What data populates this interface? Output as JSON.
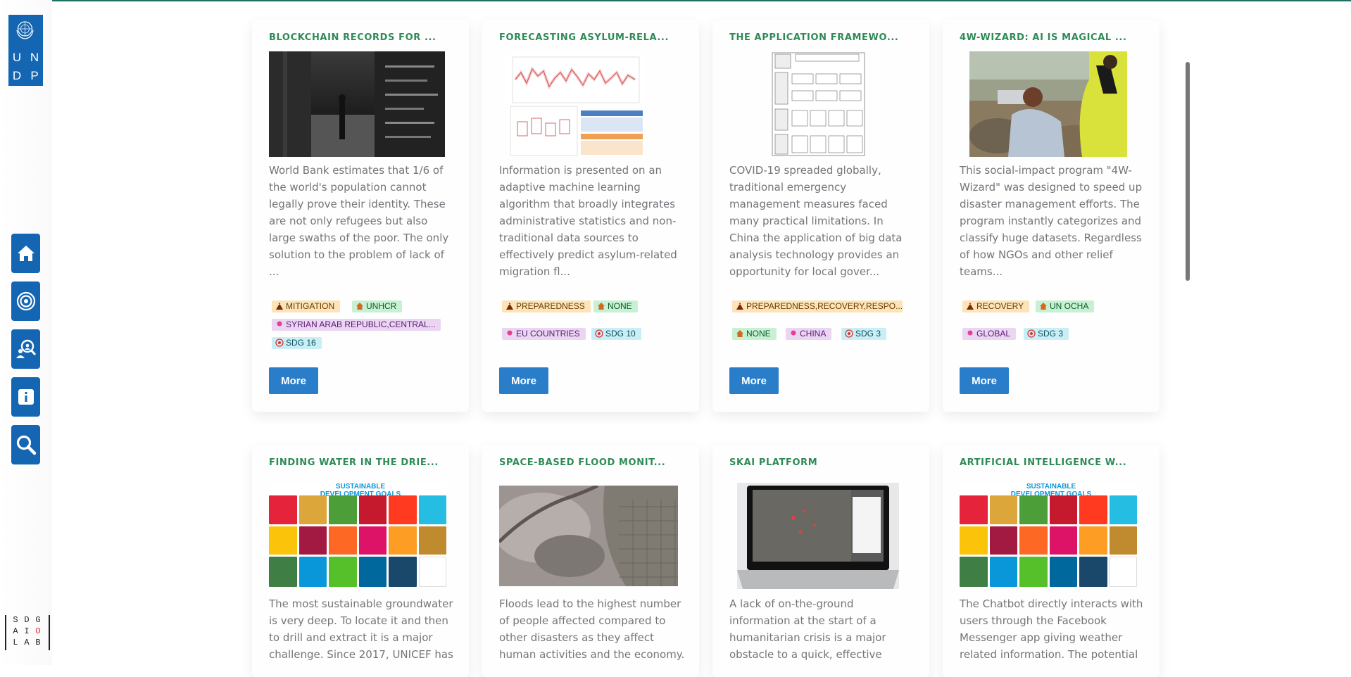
{
  "brand": {
    "undp_letters": [
      "U",
      "N",
      "D",
      "P"
    ],
    "sdg_lab_letters": [
      "S",
      "D",
      "G",
      "A",
      "I",
      "O",
      "L",
      "A",
      "B"
    ],
    "color_primary": "#1466b3",
    "color_title": "#2e8b57"
  },
  "sidebar": {
    "items": [
      {
        "name": "home",
        "icon": "home-icon"
      },
      {
        "name": "target",
        "icon": "target-icon"
      },
      {
        "name": "explore",
        "icon": "magnifier-people-icon"
      },
      {
        "name": "info",
        "icon": "info-icon"
      },
      {
        "name": "search",
        "icon": "search-icon"
      }
    ]
  },
  "cards": [
    {
      "title": "BLOCKCHAIN RECORDS FOR ...",
      "text": "World Bank estimates that 1/6 of the world's population cannot legally prove their identity. These are not only refugees but also large swaths of the poor. The only solution to the problem of lack of ...",
      "tags": [
        "MITIGATION",
        "UNHCR",
        "SYRIAN ARAB REPUBLIC,CENTRAL...",
        "SDG 16"
      ],
      "more": "More"
    },
    {
      "title": "FORECASTING ASYLUM-RELA...",
      "text": "Information is presented on an adaptive machine learning algorithm that broadly integrates administrative statistics and non-traditional data sources to effectively predict asylum-related migration fl...",
      "tags": [
        "PREPAREDNESS",
        "NONE",
        "EU COUNTRIES",
        "SDG 10"
      ],
      "more": "More"
    },
    {
      "title": "THE APPLICATION FRAMEWO...",
      "text": "COVID-19 spreaded globally, traditional emergency management measures faced many practical limitations. In China the application of big data analysis technology provides an opportunity for local gover...",
      "tags": [
        "PREPAREDNESS,RECOVERY,RESPO...",
        "NONE",
        "CHINA",
        "SDG 3"
      ],
      "more": "More"
    },
    {
      "title": "4W-WIZARD: AI IS MAGICAL ...",
      "text": "This social-impact program \"4W-Wizard\" was designed to speed up disaster management efforts. The program instantly categorizes and classify huge datasets. Regardless of how NGOs and other relief teams...",
      "tags": [
        "RECOVERY",
        "UN OCHA",
        "GLOBAL",
        "SDG 3"
      ],
      "more": "More"
    },
    {
      "title": "FINDING WATER IN THE DRIE...",
      "text": "The most sustainable groundwater is very deep. To locate it and then to drill and extract it is a major challenge. Since 2017, UNICEF has"
    },
    {
      "title": "SPACE-BASED FLOOD MONIT...",
      "text": "Floods lead to the highest number of people affected compared to other disasters as they affect human activities and the economy."
    },
    {
      "title": "SKAI PLATFORM",
      "text": "A lack of on-the-ground information at the start of a humanitarian crisis is a major obstacle to a quick, effective"
    },
    {
      "title": "ARTIFICIAL INTELLIGENCE W...",
      "text": "The Chatbot directly interacts with users through the Facebook Messenger app giving weather related information. The potential"
    }
  ],
  "sdg_poster": {
    "header": "SUSTAINABLE DEVELOPMENT GOALS",
    "tile_colors": [
      "#e5243b",
      "#dda63a",
      "#4c9f38",
      "#c5192d",
      "#ff3a21",
      "#26bde2",
      "#fcc30b",
      "#a21942",
      "#fd6925",
      "#dd1367",
      "#fd9d24",
      "#bf8b2e",
      "#3f7e44",
      "#0a97d9",
      "#56c02b",
      "#00689d",
      "#19486a",
      "#ffffff"
    ]
  }
}
